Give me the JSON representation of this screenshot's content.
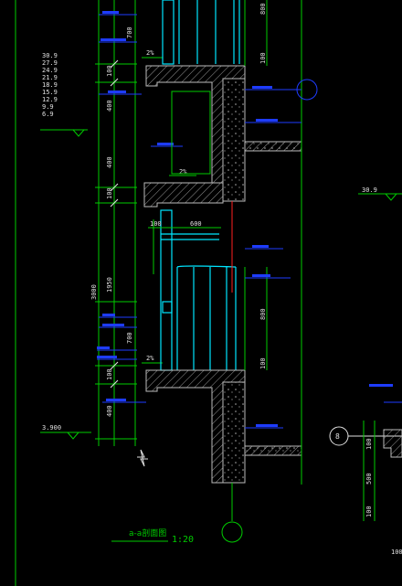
{
  "drawing": {
    "title": "a-a剖面图",
    "scale": "1:20",
    "levels": [
      "30.9",
      "27.9",
      "24.9",
      "21.9",
      "18.9",
      "15.9",
      "12.9",
      "9.9",
      "6.9"
    ],
    "level_right": "30.9",
    "level_bottom": "3.900",
    "dims_vertical_left": {
      "total": "3000",
      "d1950": "1950",
      "d700a": "700",
      "d700b": "700",
      "d100a": "100",
      "d100b": "100",
      "d100c": "100",
      "d400a": "400",
      "d400b": "400",
      "d400c": "400"
    },
    "dims_vertical_right": {
      "d800a": "800",
      "d800b": "800",
      "d100a": "100",
      "d100b": "100"
    },
    "dims_horizontal": {
      "d100": "100",
      "d600": "600"
    },
    "slopes": [
      "2%",
      "2%",
      "2%"
    ],
    "corner_dims": {
      "d100": "100",
      "d500": "500",
      "d100b": "100"
    },
    "circle_label": "8",
    "bottom_right_number": "100"
  },
  "colors": {
    "background": "#000000",
    "line_green": "#00cc00",
    "line_cyan": "#00e5ff",
    "line_blue": "#1e3cff",
    "line_white": "#e0e0e0",
    "line_red": "#ff2020",
    "hatch": "#888888"
  }
}
